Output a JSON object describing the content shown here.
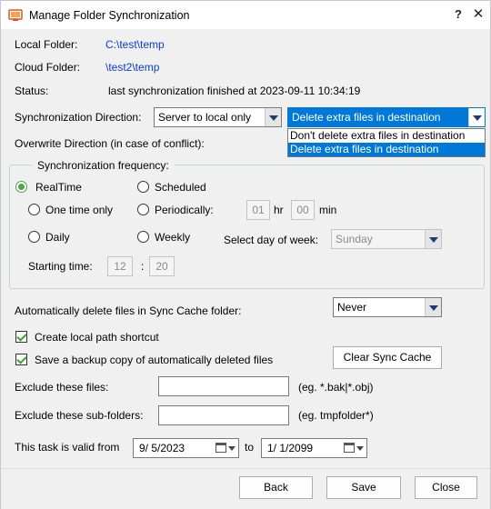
{
  "window": {
    "title": "Manage Folder Synchronization",
    "help_glyph": "?",
    "close_glyph": "✕"
  },
  "info": {
    "local_folder_label": "Local Folder:",
    "local_folder_value": "C:\\test\\temp",
    "cloud_folder_label": "Cloud Folder:",
    "cloud_folder_value": "\\test2\\temp",
    "status_label": "Status:",
    "status_value": "last synchronization finished at 2023-09-11 10:34:19"
  },
  "direction": {
    "label": "Synchronization Direction:",
    "selected": "Server to local only",
    "extra_selected": "Delete extra files in destination",
    "extra_options": [
      "Don't delete extra files in destination",
      "Delete extra files in destination"
    ],
    "overwrite_label": "Overwrite Direction (in case of conflict):"
  },
  "frequency": {
    "group_title": "Synchronization frequency:",
    "realtime": "RealTime",
    "scheduled": "Scheduled",
    "one_time": "One time only",
    "periodically": "Periodically:",
    "hr_value": "01",
    "hr_unit": "hr",
    "min_value": "00",
    "min_unit": "min",
    "daily": "Daily",
    "weekly": "Weekly",
    "day_of_week_label": "Select day of week:",
    "day_of_week_value": "Sunday",
    "starting_time_label": "Starting time:",
    "start_hour": "12",
    "time_sep": ":",
    "start_min": "20"
  },
  "cache": {
    "auto_delete_label": "Automatically delete files in Sync Cache folder:",
    "auto_delete_value": "Never",
    "create_shortcut_label": "Create local path shortcut",
    "backup_copy_label": "Save a backup copy of automatically deleted files",
    "clear_cache_button": "Clear Sync Cache"
  },
  "exclude": {
    "files_label": "Exclude these files:",
    "files_hint": "(eg. *.bak|*.obj)",
    "folders_label": "Exclude these sub-folders:",
    "folders_hint": "(eg. tmpfolder*)"
  },
  "validity": {
    "label": "This task is valid from",
    "from_date": "9/  5/2023",
    "to_label": "to",
    "to_date": "1/  1/2099"
  },
  "buttons": {
    "back": "Back",
    "save": "Save",
    "close": "Close"
  },
  "colors": {
    "link": "#0b3fd0",
    "selection": "#0078d7",
    "radio_on": "#4fa64a",
    "check": "#3c9e3c"
  }
}
